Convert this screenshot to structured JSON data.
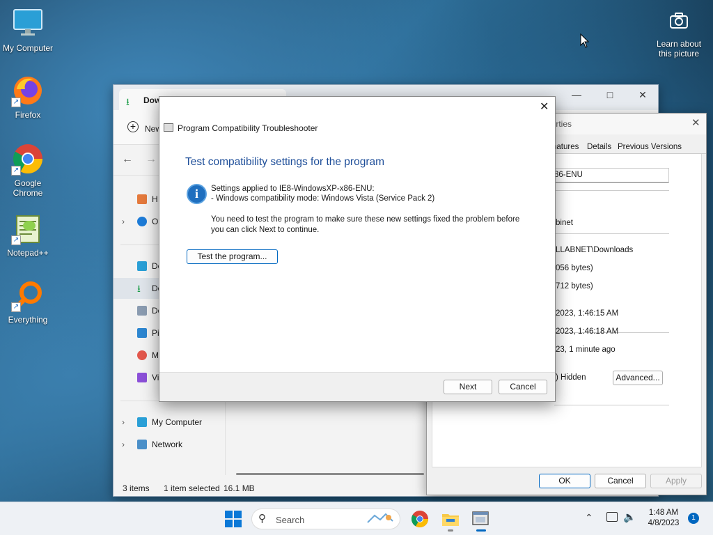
{
  "desktop": {
    "icons": [
      {
        "label": "My Computer",
        "icon": "monitor-icon"
      },
      {
        "label": "Firefox",
        "icon": "firefox-icon"
      },
      {
        "label": "Google Chrome",
        "icon": "chrome-icon"
      },
      {
        "label": "Notepad++",
        "icon": "notepadpp-icon"
      },
      {
        "label": "Everything",
        "icon": "everything-icon"
      }
    ],
    "learn_about": "Learn about this picture"
  },
  "explorer": {
    "tab_title": "Dow",
    "new_label": "New",
    "nav": [
      "H",
      "O",
      "De",
      "Do",
      "Do",
      "Pi",
      "M",
      "Vi"
    ],
    "tree": [
      "My Computer",
      "Network"
    ],
    "status": {
      "items": "3 items",
      "selected": "1 item selected",
      "size": "16.1 MB"
    }
  },
  "properties": {
    "title_fragment": "perties",
    "tabs": [
      "natures",
      "Details",
      "Previous Versions"
    ],
    "filename_fragment": "86-ENU",
    "rows": [
      "binet",
      "LLABNET\\Downloads",
      "056 bytes)",
      "712 bytes)",
      "2023, 1:46:15 AM",
      "2023, 1:46:18 AM",
      "23, 1 minute ago"
    ],
    "hidden_label": ") Hidden",
    "advanced_label": "Advanced...",
    "ok_label": "OK",
    "cancel_label": "Cancel",
    "apply_label": "Apply"
  },
  "dialog": {
    "window_title": "Program Compatibility Troubleshooter",
    "heading": "Test compatibility settings for the program",
    "settings_line1": "Settings applied to IE8-WindowsXP-x86-ENU:",
    "settings_line2": "- Windows compatibility mode: Windows Vista (Service Pack 2)",
    "instruction_line1": "You need to test the program to make sure these new settings fixed the problem before",
    "instruction_line2": "you can click Next to continue.",
    "test_button": "Test the program...",
    "next_button": "Next",
    "cancel_button": "Cancel"
  },
  "taskbar": {
    "search_placeholder": "Search",
    "time": "1:48 AM",
    "date": "4/8/2023",
    "notification_count": "1"
  },
  "colors": {
    "accent": "#0067c0",
    "heading": "#1e4e99",
    "info": "#1f6fbf"
  }
}
